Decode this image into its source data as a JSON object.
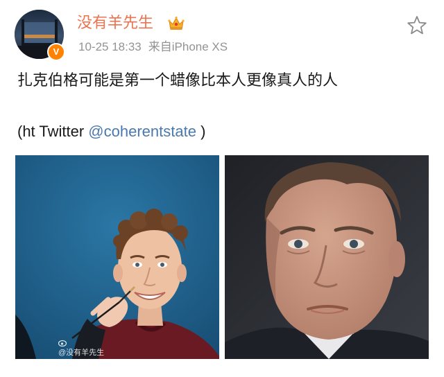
{
  "post": {
    "username": "没有羊先生",
    "verified_mark": "V",
    "time": "10-25 18:33",
    "source": "来自iPhone XS",
    "text": "扎克伯格可能是第一个蜡像比本人更像真人的人",
    "credit_prefix": "(ht Twitter ",
    "mention": "@coherentstate",
    "credit_suffix": " )"
  },
  "images": {
    "left_watermark": "@没有羊先生"
  },
  "colors": {
    "username": "#eb7350",
    "mention": "#4a79ad",
    "verified": "#ff8200",
    "meta": "#939393"
  },
  "icons": {
    "crown": "vip-crown-icon",
    "star": "star-outline-icon",
    "badge": "verified-badge-icon"
  }
}
